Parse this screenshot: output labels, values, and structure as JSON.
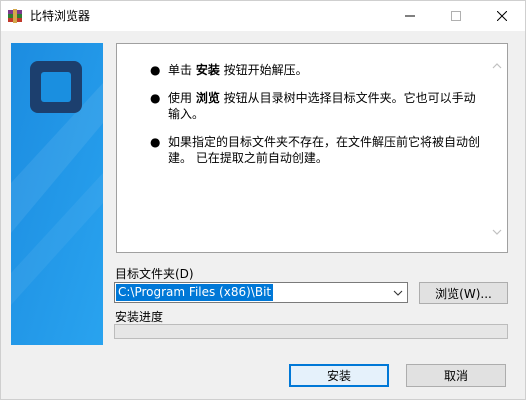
{
  "window": {
    "title": "比特浏览器",
    "icon": "winrar-books-icon"
  },
  "titlebar_buttons": {
    "minimize": "minimize-icon",
    "maximize": "maximize-icon",
    "close": "close-icon"
  },
  "side_panel": {
    "logo": "app-logo-icon",
    "color": "#1a8fe0"
  },
  "info": {
    "items": [
      {
        "pre": "单击 ",
        "bold": "安装",
        "post": " 按钮开始解压。"
      },
      {
        "pre": "使用 ",
        "bold": "浏览",
        "post": " 按钮从目录树中选择目标文件夹。它也可以手动输入。"
      },
      {
        "pre": "",
        "bold": "",
        "post": "如果指定的目标文件夹不存在，在文件解压前它将被自动创建。 已在提取之前自动创建。"
      }
    ]
  },
  "destination": {
    "label": "目标文件夹(D)",
    "value": "C:\\Program Files (x86)\\Bit",
    "browse_label": "浏览(W)..."
  },
  "progress": {
    "label": "安装进度",
    "value": 0
  },
  "buttons": {
    "install": "安装",
    "cancel": "取消"
  },
  "colors": {
    "accent": "#0078d7",
    "panel_blue": "#1a8fe0",
    "logo_navy": "#1c3f6e"
  }
}
